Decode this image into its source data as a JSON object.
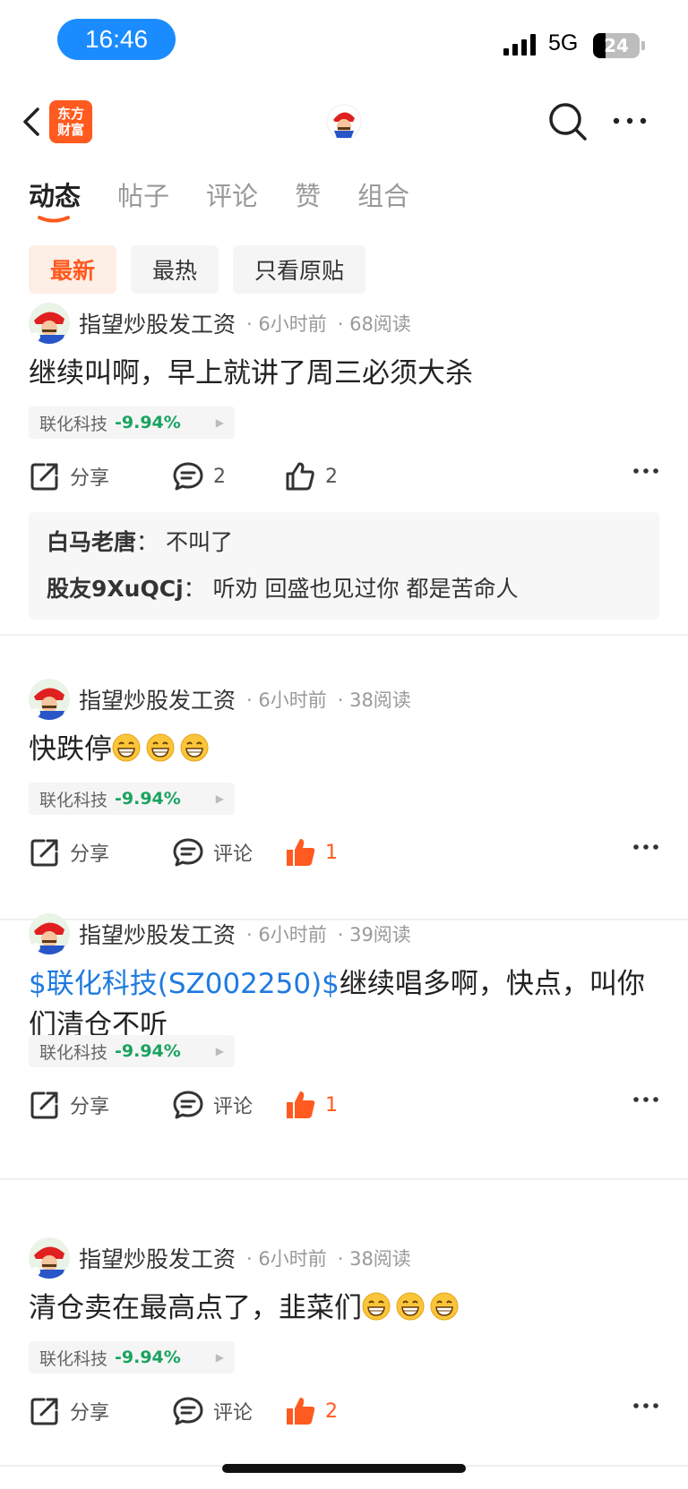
{
  "status_bar": {
    "time": "16:46",
    "network": "5G",
    "battery": "24"
  },
  "nav": {
    "logo_line1": "东方",
    "logo_line2": "财富"
  },
  "tabs": [
    {
      "label": "动态",
      "active": true
    },
    {
      "label": "帖子",
      "active": false
    },
    {
      "label": "评论",
      "active": false
    },
    {
      "label": "赞",
      "active": false
    },
    {
      "label": "组合",
      "active": false
    }
  ],
  "filters": [
    {
      "label": "最新",
      "active": true
    },
    {
      "label": "最热",
      "active": false
    },
    {
      "label": "只看原贴",
      "active": false
    }
  ],
  "posts": [
    {
      "author": "指望炒股发工资",
      "time": "· 6小时前",
      "reads": "· 68阅读",
      "text": "继续叫啊，早上就讲了周三必须大杀",
      "tag_name": "联化科技",
      "tag_pct": "-9.94%",
      "share": "分享",
      "comment": "2",
      "like": "2",
      "liked": false,
      "replies": [
        {
          "who": "白马老唐",
          "sep": "：",
          "text": "不叫了"
        },
        {
          "who": "股友9XuQCj",
          "sep": "：",
          "text": "听劝 回盛也见过你 都是苦命人"
        }
      ]
    },
    {
      "author": "指望炒股发工资",
      "time": "· 6小时前",
      "reads": "· 38阅读",
      "text": "快跌停",
      "tag_name": "联化科技",
      "tag_pct": "-9.94%",
      "share": "分享",
      "comment": "评论",
      "like": "1",
      "liked": true
    },
    {
      "author": "指望炒股发工资",
      "time": "· 6小时前",
      "reads": "· 39阅读",
      "stock_link": "$联化科技(SZ002250)$",
      "text": "继续唱多啊，快点，叫你们清仓不听",
      "tag_name": "联化科技",
      "tag_pct": "-9.94%",
      "share": "分享",
      "comment": "评论",
      "like": "1",
      "liked": true
    },
    {
      "author": "指望炒股发工资",
      "time": "· 6小时前",
      "reads": "· 38阅读",
      "text": "清仓卖在最高点了，韭菜们",
      "tag_name": "联化科技",
      "tag_pct": "-9.94%",
      "share": "分享",
      "comment": "评论",
      "like": "2",
      "liked": true
    }
  ],
  "colors": {
    "accent": "#ff5a1f",
    "link": "#1f7ae0",
    "down": "#1aa35f"
  }
}
